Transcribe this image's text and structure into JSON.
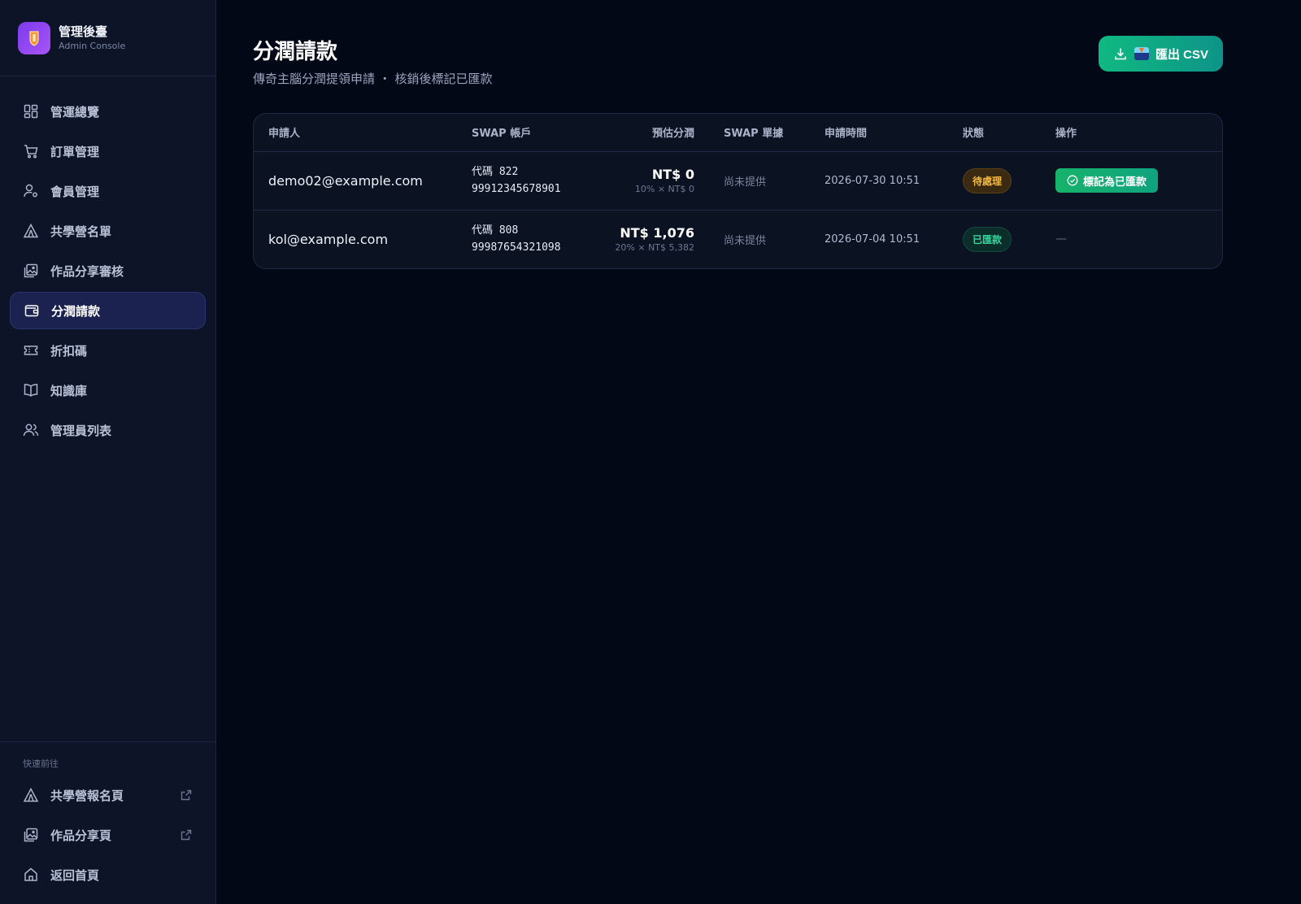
{
  "brand": {
    "title": "管理後臺",
    "subtitle": "Admin Console"
  },
  "nav": [
    {
      "label": "管運總覽",
      "icon": "dashboard-icon",
      "active": false
    },
    {
      "label": "訂單管理",
      "icon": "cart-icon",
      "active": false
    },
    {
      "label": "會員管理",
      "icon": "user-gear-icon",
      "active": false
    },
    {
      "label": "共學營名單",
      "icon": "tent-icon",
      "active": false
    },
    {
      "label": "作品分享審核",
      "icon": "gallery-icon",
      "active": false
    },
    {
      "label": "分潤請款",
      "icon": "wallet-icon",
      "active": true
    },
    {
      "label": "折扣碼",
      "icon": "ticket-icon",
      "active": false
    },
    {
      "label": "知識庫",
      "icon": "book-icon",
      "active": false
    },
    {
      "label": "管理員列表",
      "icon": "users-icon",
      "active": false
    }
  ],
  "quick_links": {
    "title": "快速前往",
    "items": [
      {
        "label": "共學營報名頁",
        "icon": "tent-icon",
        "external": true
      },
      {
        "label": "作品分享頁",
        "icon": "gallery-icon",
        "external": true
      },
      {
        "label": "返回首頁",
        "icon": "home-icon",
        "external": false
      }
    ]
  },
  "page": {
    "title": "分潤請款",
    "subtitle": "傳奇主腦分潤提領申請 ・ 核銷後標記已匯款",
    "export_label": "匯出 CSV"
  },
  "table": {
    "columns": [
      "申請人",
      "SWAP 帳戶",
      "預估分潤",
      "SWAP 單據",
      "申請時間",
      "狀態",
      "操作"
    ],
    "rows": [
      {
        "applicant": "demo02@example.com",
        "account_code": "代碼 822",
        "account_number": "99912345678901",
        "amount": "NT$ 0",
        "amount_detail": "10% × NT$ 0",
        "receipt": "尚未提供",
        "time": "2026-07-30 10:51",
        "status": "待處理",
        "status_type": "pending",
        "action": "標記為已匯款"
      },
      {
        "applicant": "kol@example.com",
        "account_code": "代碼 808",
        "account_number": "99987654321098",
        "amount": "NT$ 1,076",
        "amount_detail": "20% × NT$ 5,382",
        "receipt": "尚未提供",
        "time": "2026-07-04 10:51",
        "status": "已匯款",
        "status_type": "paid",
        "action": "—"
      }
    ]
  },
  "colors": {
    "background": "#030817",
    "sidebar": "#0d1428",
    "accent_green": "#10b981",
    "active_nav": "#1c2250",
    "pending": "#f5b93b",
    "paid": "#34d399"
  }
}
